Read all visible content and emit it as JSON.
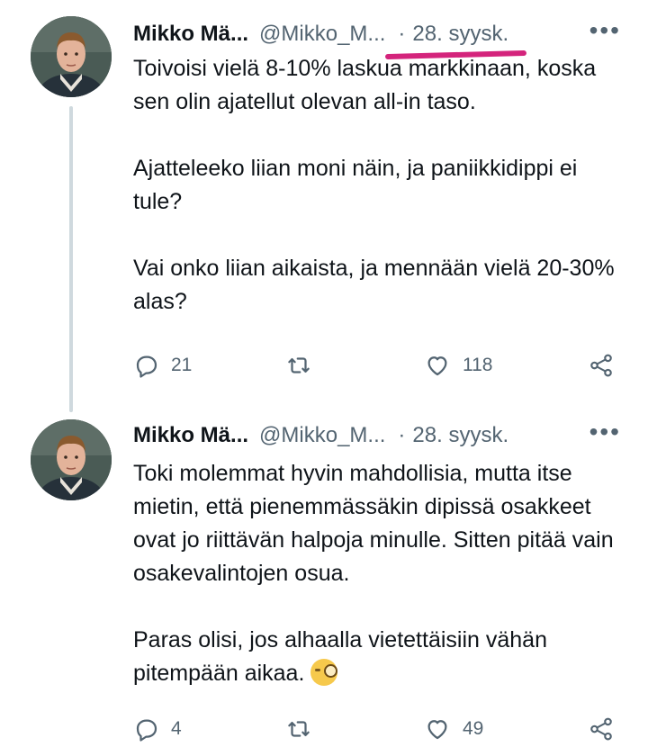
{
  "tweets": [
    {
      "author": "Mikko Mä...",
      "handle": "@Mikko_M...",
      "separator": "·",
      "date": "28. syysk.",
      "text": "Toivoisi vielä 8-10% laskua markkinaan, koska sen olin ajatellut olevan all-in taso.\n\nAjatteleeko liian moni näin, ja paniikkidippi ei tule?\n\nVai onko liian aikaista, ja mennään vielä 20-30% alas?",
      "replies": "21",
      "retweets": "",
      "likes": "118"
    },
    {
      "author": "Mikko Mä...",
      "handle": "@Mikko_M...",
      "separator": "·",
      "date": "28. syysk.",
      "text": "Toki molemmat hyvin mahdollisia, mutta itse mietin, että pienemmässäkin dipissä osakkeet ovat jo riittävän halpoja minulle. Sitten pitää vain osakevalintojen osua.\n\nParas olisi, jos alhaalla vietettäisiin vähän pitempään aikaa.",
      "emoji": "face-with-monocle",
      "replies": "4",
      "retweets": "",
      "likes": "49"
    }
  ],
  "more_label": "•••",
  "colors": {
    "text": "#0f1419",
    "muted": "#536471",
    "thread_line": "#cfd9de",
    "annotation_underline": "#d4247c"
  },
  "icons": [
    "reply-icon",
    "retweet-icon",
    "like-icon",
    "share-icon",
    "more-icon"
  ]
}
